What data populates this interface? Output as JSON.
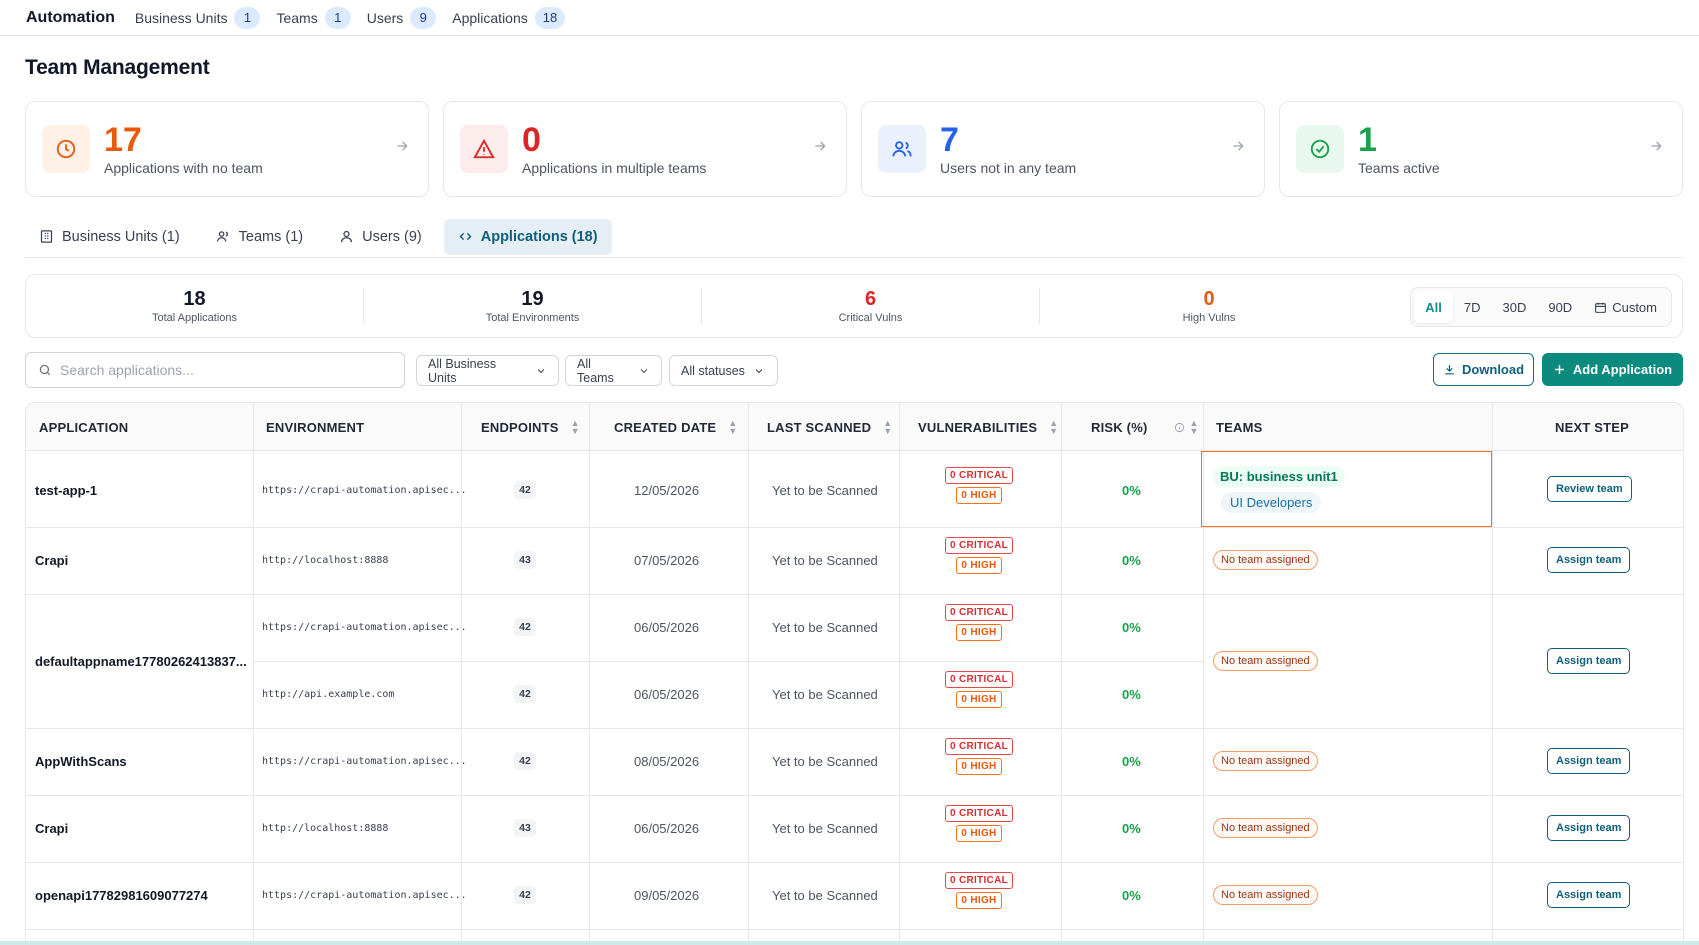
{
  "topbar": {
    "brand": "Automation",
    "nav": [
      {
        "label": "Business Units",
        "count": "1"
      },
      {
        "label": "Teams",
        "count": "1"
      },
      {
        "label": "Users",
        "count": "9"
      },
      {
        "label": "Applications",
        "count": "18"
      }
    ]
  },
  "page_title": "Team Management",
  "cards": [
    {
      "value": "17",
      "label": "Applications with no team",
      "icon": "clock-icon",
      "color": "#ea580c",
      "bg": "#fff1e6"
    },
    {
      "value": "0",
      "label": "Applications in multiple teams",
      "icon": "alert-triangle-icon",
      "color": "#dc2626",
      "bg": "#fdecec"
    },
    {
      "value": "7",
      "label": "Users not in any team",
      "icon": "users-icon",
      "color": "#2563eb",
      "bg": "#eaf1fd"
    },
    {
      "value": "1",
      "label": "Teams active",
      "icon": "check-circle-icon",
      "color": "#16a34a",
      "bg": "#e9f8ef"
    }
  ],
  "tabs": [
    {
      "label": "Business Units (1)",
      "icon": "building-icon"
    },
    {
      "label": "Teams (1)",
      "icon": "users-icon"
    },
    {
      "label": "Users (9)",
      "icon": "user-icon"
    },
    {
      "label": "Applications (18)",
      "icon": "code-icon",
      "active": true
    }
  ],
  "summary": [
    {
      "value": "18",
      "label": "Total Applications",
      "color": "#111827"
    },
    {
      "value": "19",
      "label": "Total Environments",
      "color": "#111827"
    },
    {
      "value": "6",
      "label": "Critical Vulns",
      "color": "#dc2626"
    },
    {
      "value": "0",
      "label": "High Vulns",
      "color": "#ea580c"
    }
  ],
  "ranges": [
    "All",
    "7D",
    "30D",
    "90D",
    "Custom"
  ],
  "active_range": "All",
  "search": {
    "placeholder": "Search applications..."
  },
  "filters": [
    "All Business Units",
    "All Teams",
    "All statuses"
  ],
  "actions": {
    "download": "Download",
    "add": "Add Application"
  },
  "table": {
    "headers": {
      "application": "APPLICATION",
      "environment": "ENVIRONMENT",
      "endpoints": "ENDPOINTS",
      "created": "CREATED DATE",
      "scanned": "LAST SCANNED",
      "vulns": "VULNERABILITIES",
      "risk": "RISK (%)",
      "teams": "TEAMS",
      "next": "NEXT STEP"
    },
    "rows": [
      {
        "name": "test-app-1",
        "env": "https://crapi-automation.apisec...",
        "endpoints": "42",
        "created": "12/05/2026",
        "scanned": "Yet to be Scanned",
        "critical": "0 CRITICAL",
        "high": "0 HIGH",
        "risk": "0%"
      },
      {
        "name": "Crapi",
        "env": "http://localhost:8888",
        "endpoints": "43",
        "created": "07/05/2026",
        "scanned": "Yet to be Scanned",
        "critical": "0 CRITICAL",
        "high": "0 HIGH",
        "risk": "0%"
      },
      {
        "name": "defaultappname17780262413837...",
        "env": "https://crapi-automation.apisec...",
        "endpoints": "42",
        "created": "06/05/2026",
        "scanned": "Yet to be Scanned",
        "critical": "0 CRITICAL",
        "high": "0 HIGH",
        "risk": "0%"
      },
      {
        "name": "",
        "env": "http://api.example.com",
        "endpoints": "42",
        "created": "06/05/2026",
        "scanned": "Yet to be Scanned",
        "critical": "0 CRITICAL",
        "high": "0 HIGH",
        "risk": "0%"
      },
      {
        "name": "AppWithScans",
        "env": "https://crapi-automation.apisec...",
        "endpoints": "42",
        "created": "08/05/2026",
        "scanned": "Yet to be Scanned",
        "critical": "0 CRITICAL",
        "high": "0 HIGH",
        "risk": "0%"
      },
      {
        "name": "Crapi",
        "env": "http://localhost:8888",
        "endpoints": "43",
        "created": "06/05/2026",
        "scanned": "Yet to be Scanned",
        "critical": "0 CRITICAL",
        "high": "0 HIGH",
        "risk": "0%"
      },
      {
        "name": "openapi17782981609077274",
        "env": "https://crapi-automation.apisec...",
        "endpoints": "42",
        "created": "09/05/2026",
        "scanned": "Yet to be Scanned",
        "critical": "0 CRITICAL",
        "high": "0 HIGH",
        "risk": "0%"
      }
    ],
    "teams": {
      "row1_bu": "BU: business unit1",
      "row1_team": "UI Developers",
      "no_team": "No team assigned"
    },
    "next_step": {
      "review": "Review team",
      "assign": "Assign team"
    }
  }
}
